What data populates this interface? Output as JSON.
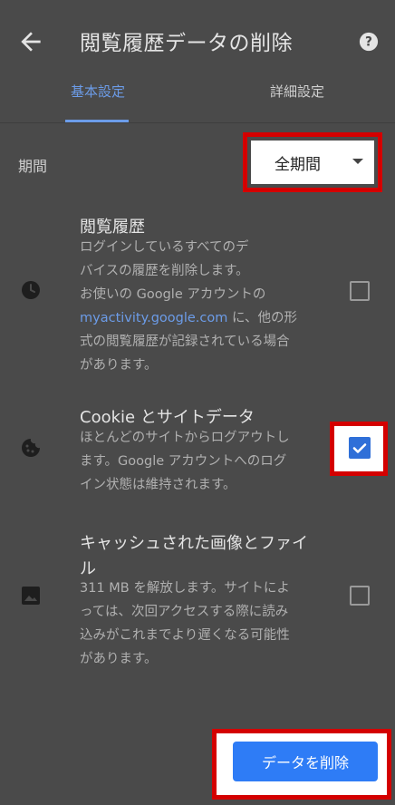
{
  "header": {
    "title": "閲覧履歴データの削除",
    "back_icon": "arrow-back-icon",
    "help_icon": "help-icon"
  },
  "tabs": [
    {
      "label": "基本設定",
      "active": true
    },
    {
      "label": "詳細設定",
      "active": false
    }
  ],
  "period": {
    "label": "期間",
    "selected": "全期間"
  },
  "items": [
    {
      "icon": "clock-icon",
      "title": "閲覧履歴",
      "desc_lines": [
        "ログインしているすべてのデ",
        "バイスの履歴を削除します。",
        "お使いの Google アカウントの"
      ],
      "link": "myactivity.google.com",
      "desc_after_link": " に、他の形",
      "desc_lines_2": [
        "式の閲覧履歴が記録されている場合",
        "があります。"
      ],
      "checked": false
    },
    {
      "icon": "cookie-icon",
      "title": "Cookie とサイトデータ",
      "desc_lines": [
        "ほとんどのサイトからログアウトし",
        "ます。Google アカウントへのログ",
        "イン状態は維持されます。"
      ],
      "checked": true
    },
    {
      "icon": "image-icon",
      "title_lines": [
        "キャッシュされた画像とファイ",
        "ル"
      ],
      "desc_lines": [
        "311 MB を解放します。サイトによ",
        "っては、次回アクセスする際に読み",
        "込みがこれまでより遅くなる可能性",
        "があります。"
      ],
      "checked": false
    }
  ],
  "footer": {
    "button_label": "データを削除"
  },
  "colors": {
    "accent": "#2e7cf6",
    "highlight": "#d40000",
    "background": "#4a4a4a"
  }
}
